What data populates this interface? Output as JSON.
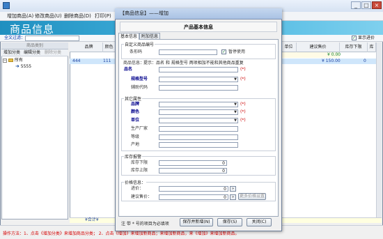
{
  "window": {
    "title": "",
    "min": "_",
    "max": "□",
    "close": "×"
  },
  "menu": [
    "增加商品(A)",
    "修改商品(U)",
    "删除商品(D)",
    "打印(P)"
  ],
  "banner": {
    "title": "商品信息"
  },
  "filter": {
    "label": "全文过滤：",
    "value": "",
    "show_price_label": "显示进价",
    "show_price_checked": true
  },
  "sidebar": {
    "header": "商品类别",
    "buttons": [
      "增加分类",
      "编辑分类",
      "删除分类"
    ],
    "tree": [
      {
        "label": "所有",
        "level": 0
      },
      {
        "label": "5555",
        "level": 1
      }
    ]
  },
  "grid": {
    "columns": [
      "品牌",
      "颜色",
      "单位",
      "建议售价",
      "库存下限",
      "库"
    ],
    "rows": [
      {
        "id": "444",
        "col2": "111",
        "price": "¥ 150.00",
        "stock_low": "0",
        "zero_price": "¥ 0.00"
      }
    ],
    "footer": "¥合计¥"
  },
  "status_tip": "操作方法：1、点击《增加分类》来增加商品分类；  2、点击《增加》来增加新商品；来增加新商品，来《增加》来增加新商品。",
  "dialog": {
    "title": "【商品信息】——增加",
    "heading": "产品基本信息",
    "tabs": [
      "基本信息",
      "附加信息"
    ],
    "custom_section": "自定义商品编号",
    "barcode_label": "条形码",
    "disable_label": "暂停使用",
    "disable_checked": true,
    "product_info_label": "商品信息：",
    "product_info_hint": "提示：品名 和 规格型号 两项相加不能和其他商品重复",
    "name_label": "品名",
    "spec_label": "规格型号",
    "helper_label": "辅助代码",
    "required_mark": "(*)",
    "other_section": "其它属性",
    "brand_label": "品牌",
    "color_label": "颜色",
    "unit_label": "单位",
    "maker_label": "生产厂家",
    "grade_label": "等级",
    "origin_label": "产地",
    "stock_section": "库存报警",
    "stock_low_label": "库存下限",
    "stock_high_label": "库存上限",
    "stock_low_value": "0",
    "stock_high_value": "0",
    "price_section": "价格信息：",
    "cost_label": "进价：",
    "suggest_label": "建议售价：",
    "cost_value": "0",
    "suggest_value": "0",
    "more_price_label": "更多价格设置",
    "note": "注 带 * 号的项目为必填项",
    "btn_save_new": "保存并新增(N)",
    "btn_save": "保存(S)",
    "btn_close": "关闭(C)"
  }
}
